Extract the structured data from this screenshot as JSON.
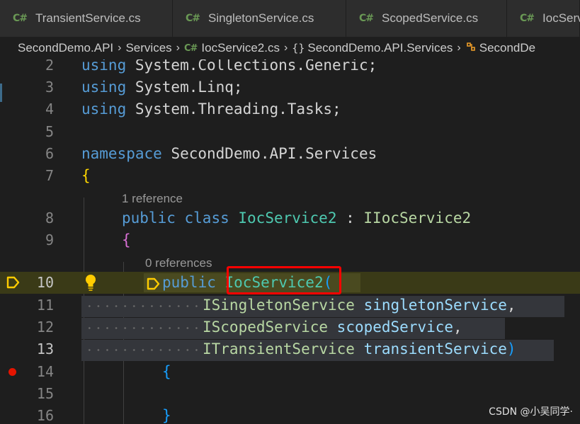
{
  "tabs": [
    {
      "icon": "C#",
      "label": "TransientService.cs"
    },
    {
      "icon": "C#",
      "label": "SingletonService.cs"
    },
    {
      "icon": "C#",
      "label": "ScopedService.cs"
    },
    {
      "icon": "C#",
      "label": "IocServ"
    }
  ],
  "breadcrumb": {
    "items": [
      "SecondDemo.API",
      "Services",
      "IocService2.cs",
      "SecondDemo.API.Services",
      "SecondDe"
    ],
    "file_icon": "C#",
    "namespace_icon": "{}"
  },
  "editor": {
    "lines": {
      "l2": {
        "num": "2",
        "using": "using",
        "rest": " System.Collections.Generic;"
      },
      "l3": {
        "num": "3",
        "using": "using",
        "rest": " System.Linq;"
      },
      "l4": {
        "num": "4",
        "using": "using",
        "rest": " System.Threading.Tasks;"
      },
      "l5": {
        "num": "5"
      },
      "l6": {
        "num": "6",
        "kw": "namespace",
        "rest": " SecondDemo.API.Services"
      },
      "l7": {
        "num": "7",
        "brace": "{"
      },
      "l8": {
        "num": "8",
        "kw1": "public",
        "kw2": "class",
        "type": "IocService2",
        "colon": " : ",
        "iface": "IIocService2"
      },
      "l9": {
        "num": "9",
        "brace": "{"
      },
      "l10": {
        "num": "10",
        "kw": "public",
        "type": "IocService2",
        "paren": "("
      },
      "l11": {
        "num": "11",
        "type": "ISingletonService",
        "param": "singletonService",
        "punct": ","
      },
      "l12": {
        "num": "12",
        "type": "IScopedService",
        "param": "scopedService",
        "punct": ","
      },
      "l13": {
        "num": "13",
        "type": "ITransientService",
        "param": "transientService",
        "punct": ")"
      },
      "l14": {
        "num": "14",
        "brace": "{"
      },
      "l15": {
        "num": "15"
      },
      "l16": {
        "num": "16",
        "brace": "}"
      }
    },
    "codelens": {
      "class_refs": "1 reference",
      "ctor_refs": "0 references"
    }
  },
  "watermark": "CSDN @小吴同学·",
  "colors": {
    "keyword": "#569cd6",
    "type": "#4ec9b0",
    "interface": "#b8d7a3",
    "parameter": "#9cdcfe",
    "brace_level1": "#ffd700",
    "brace_level2": "#da70d6",
    "brace_level3": "#179fff",
    "breakpoint": "#e51400",
    "highlight_box": "#ff0000"
  }
}
